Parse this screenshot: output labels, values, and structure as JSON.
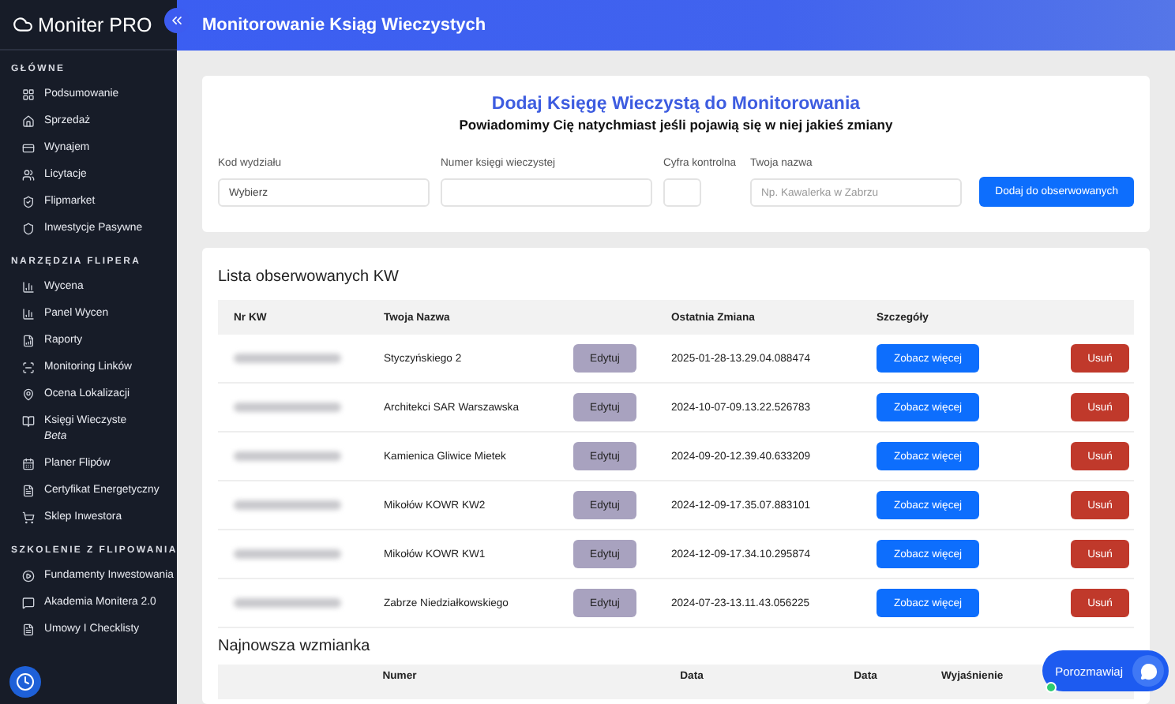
{
  "brand": {
    "name": "Moniter PRO"
  },
  "sidebar": {
    "sections": [
      {
        "title": "GŁÓWNE",
        "items": [
          {
            "label": "Podsumowanie"
          },
          {
            "label": "Sprzedaż"
          },
          {
            "label": "Wynajem"
          },
          {
            "label": "Licytacje"
          },
          {
            "label": "Flipmarket"
          },
          {
            "label": "Inwestycje Pasywne"
          }
        ]
      },
      {
        "title": "NARZĘDZIA FLIPERA",
        "items": [
          {
            "label": "Wycena"
          },
          {
            "label": "Panel Wycen"
          },
          {
            "label": "Raporty"
          },
          {
            "label": "Monitoring Linków"
          },
          {
            "label": "Ocena Lokalizacji"
          },
          {
            "label": "Księgi Wieczyste",
            "badge": "Beta"
          },
          {
            "label": "Planer Flipów"
          },
          {
            "label": "Certyfikat Energetyczny"
          },
          {
            "label": "Sklep Inwestora"
          }
        ]
      },
      {
        "title": "SZKOLENIE Z FLIPOWANIA",
        "items": [
          {
            "label": "Fundamenty Inwestowania"
          },
          {
            "label": "Akademia Monitera 2.0"
          },
          {
            "label": "Umowy I Checklisty"
          }
        ]
      }
    ]
  },
  "header": {
    "title": "Monitorowanie Ksiąg Wieczystych"
  },
  "add_form": {
    "title": "Dodaj Księgę Wieczystą do Monitorowania",
    "subtitle": "Powiadomimy Cię natychmiast jeśli pojawią się w niej jakieś zmiany",
    "fields": [
      {
        "label": "Kod wydziału",
        "value": "Wybierz",
        "kind": "select"
      },
      {
        "label": "Numer księgi wieczystej",
        "kind": "text"
      },
      {
        "label": "Cyfra kontrolna",
        "kind": "short"
      },
      {
        "label": "Twoja nazwa",
        "placeholder": "Np. Kawalerka w Zabrzu",
        "kind": "text"
      }
    ],
    "button": "Dodaj do obserwowanych"
  },
  "watch_list": {
    "title": "Lista obserwowanych KW",
    "columns": [
      "Nr KW",
      "Twoja Nazwa",
      "",
      "Ostatnia Zmiana",
      "Szczegóły",
      ""
    ],
    "rows": [
      {
        "name": "Styczyńskiego 2",
        "edit": "Edytuj",
        "changed": "2025-01-28-13.29.04.088474",
        "details": "Zobacz więcej",
        "remove": "Usuń"
      },
      {
        "name": "Architekci SAR Warszawska",
        "edit": "Edytuj",
        "changed": "2024-10-07-09.13.22.526783",
        "details": "Zobacz więcej",
        "remove": "Usuń"
      },
      {
        "name": "Kamienica Gliwice Mietek",
        "edit": "Edytuj",
        "changed": "2024-09-20-12.39.40.633209",
        "details": "Zobacz więcej",
        "remove": "Usuń"
      },
      {
        "name": "Mikołów KOWR KW2",
        "edit": "Edytuj",
        "changed": "2024-12-09-17.35.07.883101",
        "details": "Zobacz więcej",
        "remove": "Usuń"
      },
      {
        "name": "Mikołów KOWR KW1",
        "edit": "Edytuj",
        "changed": "2024-12-09-17.34.10.295874",
        "details": "Zobacz więcej",
        "remove": "Usuń"
      },
      {
        "name": "Zabrze Niedziałkowskiego",
        "edit": "Edytuj",
        "changed": "2024-07-23-13.11.43.056225",
        "details": "Zobacz więcej",
        "remove": "Usuń"
      }
    ]
  },
  "latest": {
    "title": "Najnowsza wzmianka",
    "columns": [
      "Numer",
      "Data",
      "Data",
      "Wyjaśnienie"
    ]
  },
  "chat": {
    "label": "Porozmawiaj",
    "online": true
  }
}
